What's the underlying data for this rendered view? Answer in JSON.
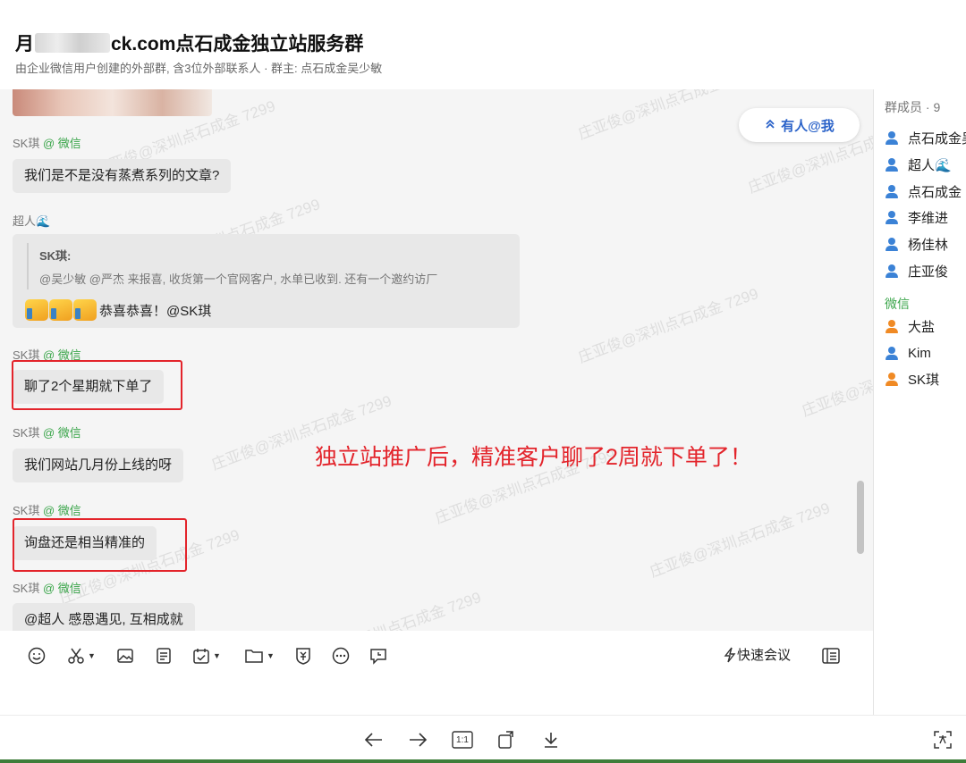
{
  "header": {
    "title_prefix": "月",
    "title_suffix": "ck.com点石成金独立站服务群",
    "subtitle": "由企业微信用户创建的外部群, 含3位外部联系人 · 群主: 点石成金吴少敏"
  },
  "chat": {
    "mention_button": "有人@我",
    "messages": [
      {
        "sender": "SK琪",
        "source": "@ 微信",
        "text": "我们是不是没有蒸煮系列的文章?"
      },
      {
        "sender": "超人🌊",
        "quote_name": "SK琪:",
        "quote_text": "@吴少敏 @严杰 来报喜, 收货第一个官网客户, 水单已收到. 还有一个邀约访厂",
        "text": "恭喜恭喜！@SK琪"
      },
      {
        "sender": "SK琪",
        "source": "@ 微信",
        "text": "聊了2个星期就下单了"
      },
      {
        "sender": "SK琪",
        "source": "@ 微信",
        "text": "我们网站几月份上线的呀"
      },
      {
        "sender": "SK琪",
        "source": "@ 微信",
        "text": "询盘还是相当精准的"
      },
      {
        "sender": "SK琪",
        "source": "@ 微信",
        "text": "@超人 感恩遇见, 互相成就"
      }
    ],
    "annotation": "独立站推广后，精准客户聊了2周就下单了！",
    "watermark": "庄亚俊@深圳点石成金 7299"
  },
  "sidebar": {
    "header": "群成员 · 9",
    "internal": [
      {
        "name": "点石成金吴",
        "color": "#3b82d6"
      },
      {
        "name": "超人🌊",
        "color": "#3b82d6"
      },
      {
        "name": "点石成金 .",
        "color": "#3b82d6"
      },
      {
        "name": "李维进",
        "color": "#3b82d6"
      },
      {
        "name": "杨佳林",
        "color": "#3b82d6"
      },
      {
        "name": "庄亚俊",
        "color": "#3b82d6"
      }
    ],
    "group_label": "微信",
    "external": [
      {
        "name": "大盐",
        "color": "#f08a24"
      },
      {
        "name": "Kim",
        "color": "#3b82d6"
      },
      {
        "name": "SK琪",
        "color": "#f08a24"
      }
    ]
  },
  "composer": {
    "tools": [
      "emoji-icon",
      "scissors-icon",
      "image-icon",
      "document-icon",
      "calendar-icon",
      "folder-icon",
      "payment-icon",
      "more-icon",
      "chat-icon"
    ],
    "meeting_label": "快速会议"
  },
  "viewer": {
    "buttons": [
      "arrow-left-icon",
      "arrow-right-icon",
      "actual-size-icon",
      "rotate-icon",
      "download-icon",
      "ocr-icon"
    ],
    "actual_size_label": "1:1"
  },
  "colors": {
    "highlight": "#e3242b",
    "wechat_green": "#3aa54a",
    "mention_blue": "#2b63c9"
  }
}
